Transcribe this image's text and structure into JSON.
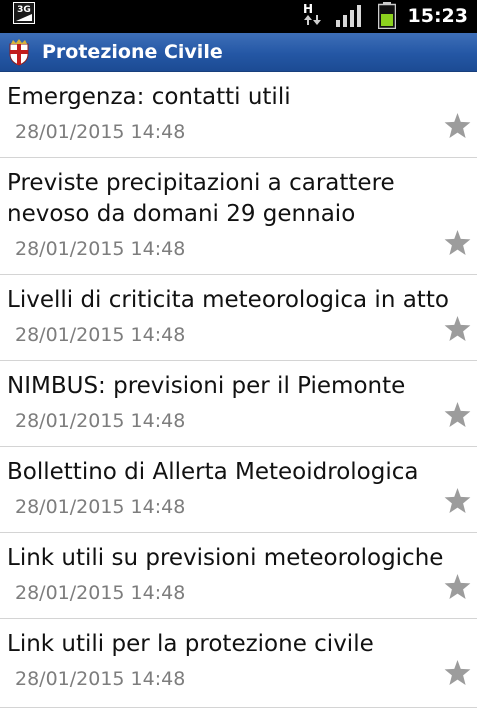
{
  "status_bar": {
    "network_badge": "3G",
    "network_type": "H",
    "icons": [
      "3g-badge-icon",
      "h-data-icon",
      "signal-icon",
      "battery-icon"
    ],
    "time": "15:23",
    "battery_color": "#8cd21e"
  },
  "app": {
    "title": "Protezione Civile",
    "icon": "coat-of-arms-icon",
    "header_color": "#2457a5"
  },
  "items": [
    {
      "title": "Emergenza: contatti utili",
      "date": "28/01/2015 14:48",
      "icon": "star-icon"
    },
    {
      "title": "Previste precipitazioni a carattere",
      "title_line2": "nevoso da domani 29 gennaio",
      "date": "28/01/2015 14:48",
      "icon": "star-icon"
    },
    {
      "title": "Livelli di criticita meteorologica in atto",
      "date": "28/01/2015 14:48",
      "icon": "star-icon"
    },
    {
      "title": "NIMBUS: previsioni per il Piemonte",
      "date": "28/01/2015 14:48",
      "icon": "star-icon"
    },
    {
      "title": "Bollettino di Allerta Meteoidrologica",
      "date": "28/01/2015 14:48",
      "icon": "star-icon"
    },
    {
      "title": "Link utili su previsioni meteorologiche",
      "date": "28/01/2015 14:48",
      "icon": "star-icon"
    },
    {
      "title": "Link utili per la protezione civile",
      "date": "28/01/2015 14:48",
      "icon": "star-icon"
    }
  ]
}
